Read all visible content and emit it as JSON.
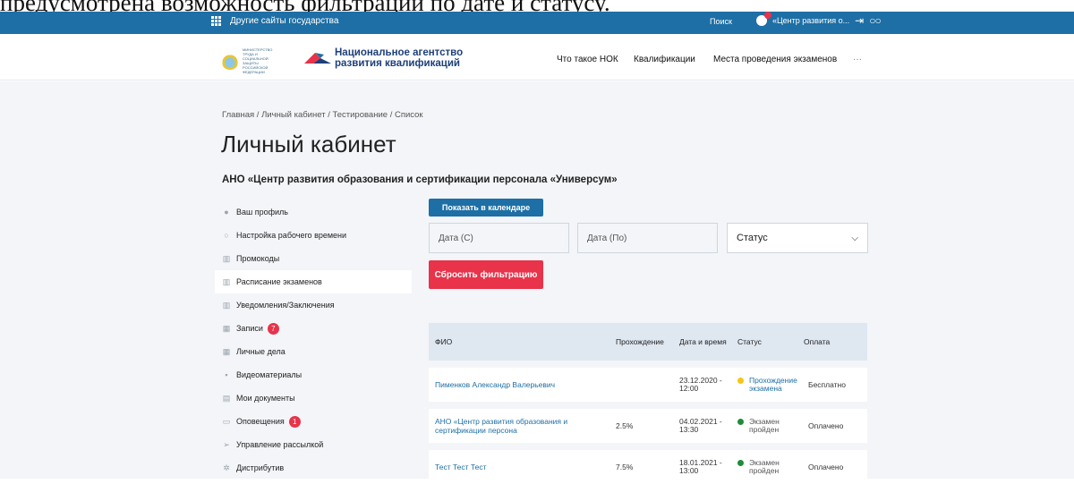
{
  "caption": "предусмотрена возможность фильтрации по дате и статусу.",
  "topbar": {
    "gov_sites": "Другие сайты государства",
    "search": "Поиск",
    "user_name": "«Центр развития о..."
  },
  "header": {
    "ministry": "МИНИСТЕРСТВО ТРУДА И СОЦИАЛЬНОЙ ЗАЩИТЫ РОССИЙСКОЙ ФЕДЕРАЦИИ",
    "agency_line1": "Национальное агентство",
    "agency_line2": "развития квалификаций",
    "nav": [
      "Что такое НОК",
      "Квалификации",
      "Места проведения экзаменов",
      "···"
    ]
  },
  "breadcrumb": "Главная / Личный кабинет / Тестирование / Список",
  "page_title": "Личный кабинет",
  "org_name": "АНО «Центр развития образования и сертификации персонала «Универсум»",
  "sidebar": {
    "items": [
      {
        "label": "Ваш профиль",
        "icon": "person-icon"
      },
      {
        "label": "Настройка рабочего времени",
        "icon": "location-icon"
      },
      {
        "label": "Промокоды",
        "icon": "ticket-icon"
      },
      {
        "label": "Расписание экзаменов",
        "icon": "ticket-icon"
      },
      {
        "label": "Уведомления/Заключения",
        "icon": "ticket-icon"
      },
      {
        "label": "Записи",
        "icon": "calendar-icon",
        "badge": "7"
      },
      {
        "label": "Личные дела",
        "icon": "calendar-icon"
      },
      {
        "label": "Видеоматериалы",
        "icon": "video-icon"
      },
      {
        "label": "Мои документы",
        "icon": "document-icon"
      },
      {
        "label": "Оповещения",
        "icon": "keyboard-icon",
        "badge": "1"
      },
      {
        "label": "Управление рассылкой",
        "icon": "send-icon"
      },
      {
        "label": "Дистрибутив",
        "icon": "gear-icon"
      }
    ]
  },
  "filters": {
    "calendar_button": "Показать в календаре",
    "date_from": "Дата (С)",
    "date_to": "Дата (По)",
    "status": "Статус",
    "reset_button": "Сбросить фильтрацию"
  },
  "table": {
    "headers": {
      "name": "ФИО",
      "progress": "Прохождение",
      "datetime": "Дата и время",
      "status": "Статус",
      "payment": "Оплата"
    },
    "rows": [
      {
        "name": "Пименков Александр Валерьевич",
        "progress": "",
        "datetime": "23.12.2020 - 12:00",
        "status": "Прохождение экзамена",
        "status_color": "#f5c518",
        "payment": "Бесплатно"
      },
      {
        "name": "АНО «Центр развития образования и сертификации персона",
        "progress": "2.5%",
        "datetime": "04.02.2021 - 13:30",
        "status": "Экзамен пройден",
        "status_color": "#1e8c3a",
        "payment": "Оплачено"
      },
      {
        "name": "Тест Тест Тест",
        "progress": "7.5%",
        "datetime": "18.01.2021 - 13:00",
        "status": "Экзамен пройден",
        "status_color": "#1e8c3a",
        "payment": "Оплачено"
      }
    ]
  },
  "colors": {
    "brand_blue": "#1d6fa5",
    "accent_red": "#e8334a",
    "header_row": "#dfe7f1",
    "page_bg": "#f3f5f8"
  }
}
